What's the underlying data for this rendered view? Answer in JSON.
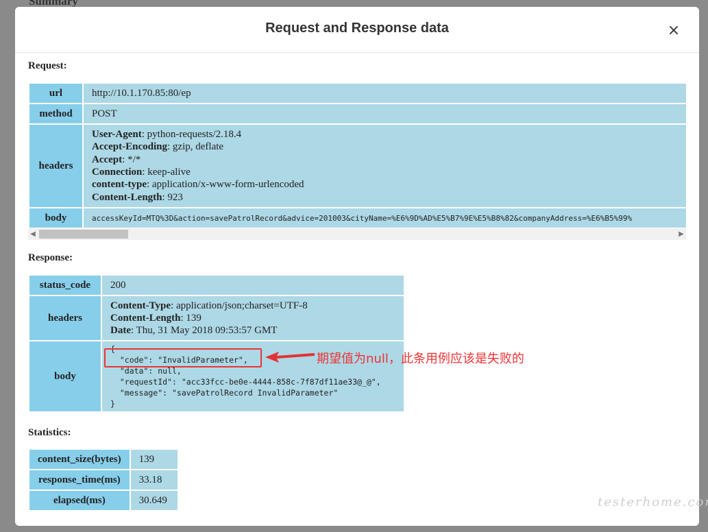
{
  "background": {
    "title": "Summary"
  },
  "dialog": {
    "title": "Request and Response data",
    "close_label": "×"
  },
  "request": {
    "label": "Request:",
    "url": {
      "key": "url",
      "value": "http://10.1.170.85:80/ep"
    },
    "method": {
      "key": "method",
      "value": "POST"
    },
    "headers": {
      "key": "headers",
      "items": [
        {
          "name": "User-Agent",
          "value": ": python-requests/2.18.4"
        },
        {
          "name": "Accept-Encoding",
          "value": ": gzip, deflate"
        },
        {
          "name": "Accept",
          "value": ": */*"
        },
        {
          "name": "Connection",
          "value": ": keep-alive"
        },
        {
          "name": "content-type",
          "value": ": application/x-www-form-urlencoded"
        },
        {
          "name": "Content-Length",
          "value": ": 923"
        }
      ]
    },
    "body": {
      "key": "body",
      "value": "accessKeyId=MTQ%3D&action=savePatrolRecord&advice=201003&cityName=%E6%9D%AD%E5%B7%9E%E5%B8%82&companyAddress=%E6%B5%99%"
    }
  },
  "response": {
    "label": "Response:",
    "status_code": {
      "key": "status_code",
      "value": "200"
    },
    "headers": {
      "key": "headers",
      "items": [
        {
          "name": "Content-Type",
          "value": ": application/json;charset=UTF-8"
        },
        {
          "name": "Content-Length",
          "value": ": 139"
        },
        {
          "name": "Date",
          "value": ": Thu, 31 May 2018 09:53:57 GMT"
        }
      ]
    },
    "body": {
      "key": "body",
      "value": "{\n  \"code\": \"InvalidParameter\",\n  \"data\": null,\n  \"requestId\": \"acc33fcc-be0e-4444-858c-7f87df11ae33@_@\",\n  \"message\": \"savePatrolRecord InvalidParameter\"\n}"
    }
  },
  "statistics": {
    "label": "Statistics:",
    "rows": [
      {
        "key": "content_size(bytes)",
        "value": "139"
      },
      {
        "key": "response_time(ms)",
        "value": "33.18"
      },
      {
        "key": "elapsed(ms)",
        "value": "30.649"
      }
    ]
  },
  "annotation": {
    "text": "期望值为null，此条用例应该是失败的",
    "color": "#e33333"
  },
  "colors": {
    "header_cell": "#87ceea",
    "value_cell": "#add8e6"
  },
  "watermark": "testerhome.com"
}
